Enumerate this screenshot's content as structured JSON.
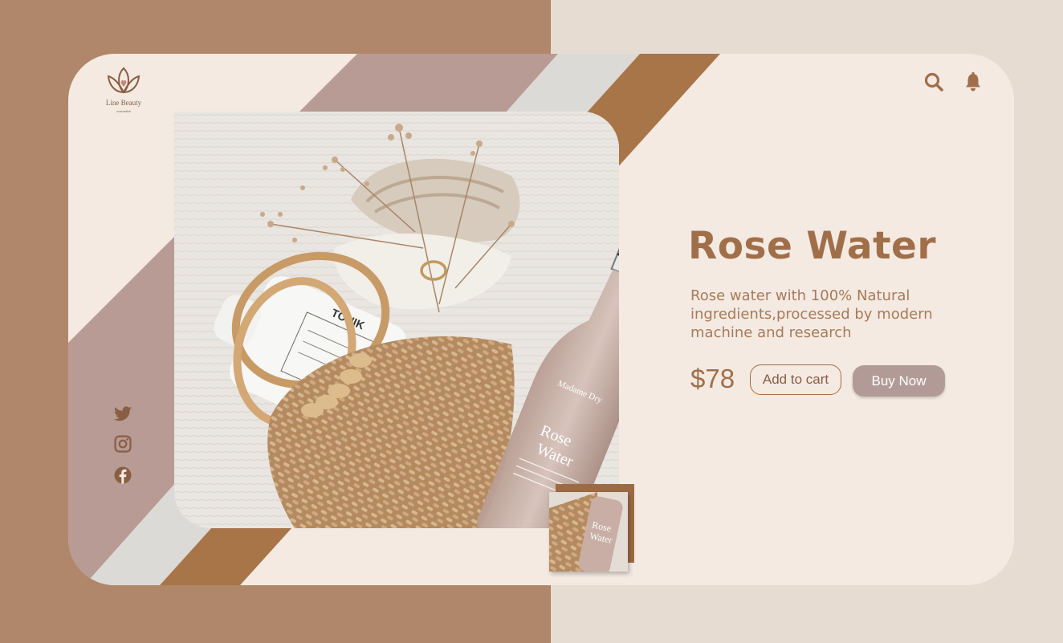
{
  "brand": {
    "name": "Line Beauty",
    "tagline": "cosmetics"
  },
  "header": {
    "icons": [
      "search-icon",
      "bell-icon"
    ]
  },
  "social": {
    "icons": [
      "twitter-icon",
      "instagram-icon",
      "facebook-icon"
    ]
  },
  "product": {
    "title": "Rose Water",
    "description": "Rose water  with 100% Natural ingredients,processed by modern machine and research",
    "price": "$78",
    "add_to_cart_label": "Add to cart",
    "buy_now_label": "Buy Now",
    "bottle_brand": "Madame Dry",
    "bottle_label": "Rose Water",
    "bottle_label_line1": "Rose",
    "bottle_label_line2": "Water",
    "box_label": "TONIK"
  },
  "colors": {
    "accent_brown": "#a06f4a",
    "mauve": "#b29b96",
    "card_bg": "#f4eae2",
    "left_bg": "#b0876a",
    "right_bg": "#e6dcd2"
  }
}
